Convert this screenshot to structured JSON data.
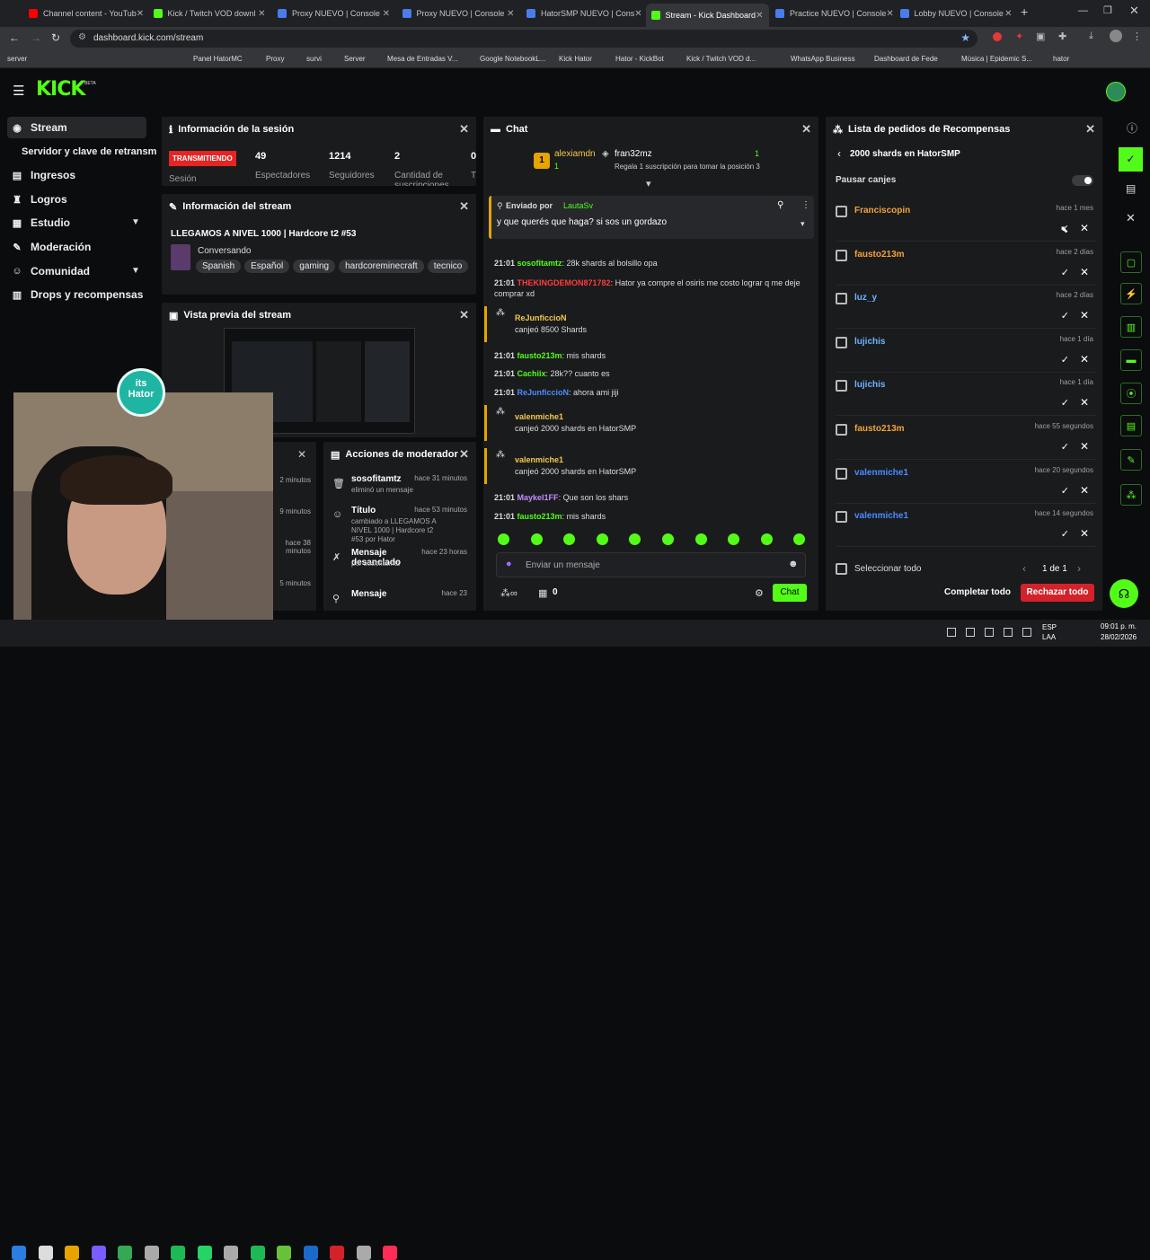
{
  "browser": {
    "tabs": [
      {
        "label": "Channel content - YouTub",
        "color": "#ff0000"
      },
      {
        "label": "Kick / Twitch VOD downl",
        "color": "#53fc18"
      },
      {
        "label": "Proxy NUEVO | Console",
        "color": "#4b7bec"
      },
      {
        "label": "Proxy NUEVO | Console",
        "color": "#4b7bec"
      },
      {
        "label": "HatorSMP NUEVO | Cons",
        "color": "#4b7bec"
      },
      {
        "label": "Stream - Kick Dashboard",
        "color": "#53fc18"
      },
      {
        "label": "Practice NUEVO | Console",
        "color": "#4b7bec"
      },
      {
        "label": "Lobby NUEVO | Console",
        "color": "#4b7bec"
      }
    ],
    "url": "dashboard.kick.com/stream",
    "bookmarks": [
      "server",
      "Panel HatorMC",
      "Proxy",
      "survi",
      "Server",
      "Mesa de Entradas V...",
      "Google NotebookL...",
      "Kick Hator",
      "Hator - KickBot",
      "Kick / Twitch VOD d...",
      "WhatsApp Business",
      "Dashboard de Fede",
      "Música | Epidemic S...",
      "hator"
    ]
  },
  "header": {
    "logo": "KICK",
    "beta": "BETA"
  },
  "sidebar": {
    "items": [
      {
        "label": "Stream",
        "icon": "broadcast-icon",
        "glyph": "◉"
      },
      {
        "label": "Servidor y clave de retransm",
        "icon": "",
        "glyph": ""
      },
      {
        "label": "Ingresos",
        "icon": "bank-icon",
        "glyph": "▤"
      },
      {
        "label": "Logros",
        "icon": "trophy-icon",
        "glyph": "♜"
      },
      {
        "label": "Estudio",
        "icon": "studio-icon",
        "glyph": "▦"
      },
      {
        "label": "Moderación",
        "icon": "wrench-icon",
        "glyph": "✎"
      },
      {
        "label": "Comunidad",
        "icon": "community-icon",
        "glyph": "☺"
      },
      {
        "label": "Drops y recompensas",
        "icon": "gift-icon",
        "glyph": "▥"
      }
    ]
  },
  "session": {
    "title": "Información de la sesión",
    "badge": "TRANSMITIENDO",
    "badge_sub": "Sesión",
    "stats": [
      {
        "v": "49",
        "l": "Espectadores"
      },
      {
        "v": "1214",
        "l": "Seguidores"
      },
      {
        "v": "2",
        "l": "Cantidad de suscripciones"
      },
      {
        "v": "0",
        "l": "T"
      }
    ]
  },
  "stream_info": {
    "title": "Información del stream",
    "stream_title": "LLEGAMOS A NIVEL 1000 | Hardcore t2 #53",
    "category": "Conversando",
    "tags": [
      "Spanish",
      "Español",
      "gaming",
      "hardcoreminecraft",
      "tecnico"
    ]
  },
  "preview": {
    "title": "Vista previa del stream"
  },
  "overlay": {
    "logo_top": "its",
    "logo_bottom": "Hator"
  },
  "mod_actions": {
    "title": "Acciones de moderador",
    "partial_times": [
      "2 minutos",
      "9 minutos",
      "hace 38 minutos",
      "5 minutos"
    ],
    "items": [
      {
        "title": "sosofitamtz",
        "sub": "eliminó un mensaje",
        "time": "hace 31 minutos"
      },
      {
        "title": "Título",
        "sub": "cambiado a LLEGAMOS A NIVEL 1000 | Hardcore t2 #53 por Hator",
        "time": "hace 53 minutos"
      },
      {
        "title": "Mensaje desanclado",
        "sub": "por sosofitamtz",
        "time": "hace 23 horas"
      },
      {
        "title": "Mensaje",
        "sub": "",
        "time": "hace 23"
      }
    ]
  },
  "chat": {
    "title": "Chat",
    "top": [
      {
        "name": "alexiamdn",
        "count": "1"
      },
      {
        "name": "fran32mz",
        "count": "1"
      }
    ],
    "top_note": "Regala 1 suscripción para tomar la posición 3",
    "pinned_by": "Enviado por",
    "pinned_user": "LautaSv",
    "pinned_msg": "y que querés que haga? si sos un gordazo",
    "lines": [
      {
        "t": "21:01",
        "u": "sosofitamtz",
        "m": ": 28k shards al bolsillo opa",
        "c": "#53fc18"
      },
      {
        "t": "21:01",
        "u": "THEKINGDEMON871782",
        "m": ": Hator ya compre el osiris me costo lograr q me deje comprar xd",
        "c": "#ff3b3b"
      },
      {
        "t": "21:01",
        "u": "fausto213m",
        "m": ": mis shards",
        "c": "#53fc18"
      },
      {
        "t": "21:01",
        "u": "Cachiix",
        "m": ": 28k?? cuanto es",
        "c": "#53fc18"
      },
      {
        "t": "21:01",
        "u": "ReJunficcioN",
        "m": ": ahora ami jiji",
        "c": "#4b8bff"
      },
      {
        "t": "21:01",
        "u": "Maykel1FF",
        "m": ": Que son los shars",
        "c": "#c58cff"
      },
      {
        "t": "21:01",
        "u": "fausto213m",
        "m": ": mis shards",
        "c": "#53fc18"
      }
    ],
    "redeems": [
      {
        "u": "ReJunficcioN",
        "m": "canjeó 8500 Shards"
      },
      {
        "u": "valenmiche1",
        "m": "canjeó 2000 shards en HatorSMP"
      },
      {
        "u": "valenmiche1",
        "m": "canjeó 2000 shards en HatorSMP"
      }
    ],
    "placeholder": "Enviar un mensaje",
    "count": "0",
    "send": "Chat"
  },
  "rewards": {
    "title": "Lista de pedidos de Recompensas",
    "subtitle": "2000 shards en HatorSMP",
    "pause": "Pausar canjes",
    "rows": [
      {
        "user": "Franciscopin",
        "time": "hace 1 mes",
        "color": "#f2a33a"
      },
      {
        "user": "fausto213m",
        "time": "hace 2 días",
        "color": "#f2a33a"
      },
      {
        "user": "luz_y",
        "time": "hace 2 días",
        "color": "#6fb3ff"
      },
      {
        "user": "lujichis",
        "time": "hace 1 día",
        "color": "#6fb3ff"
      },
      {
        "user": "lujichis",
        "time": "hace 1 día",
        "color": "#6fb3ff"
      },
      {
        "user": "fausto213m",
        "time": "hace 55 segundos",
        "color": "#f2a33a"
      },
      {
        "user": "valenmiche1",
        "time": "hace 20 segundos",
        "color": "#4b8bff"
      },
      {
        "user": "valenmiche1",
        "time": "hace 14 segundos",
        "color": "#4b8bff"
      }
    ],
    "select_all": "Seleccionar todo",
    "page": "1 de 1",
    "complete_all": "Completar todo",
    "reject_all": "Rechazar todo"
  },
  "taskbar": {
    "lang": "ESP",
    "lang2": "LAA",
    "time": "09:01 p. m.",
    "date": "28/02/2026"
  }
}
